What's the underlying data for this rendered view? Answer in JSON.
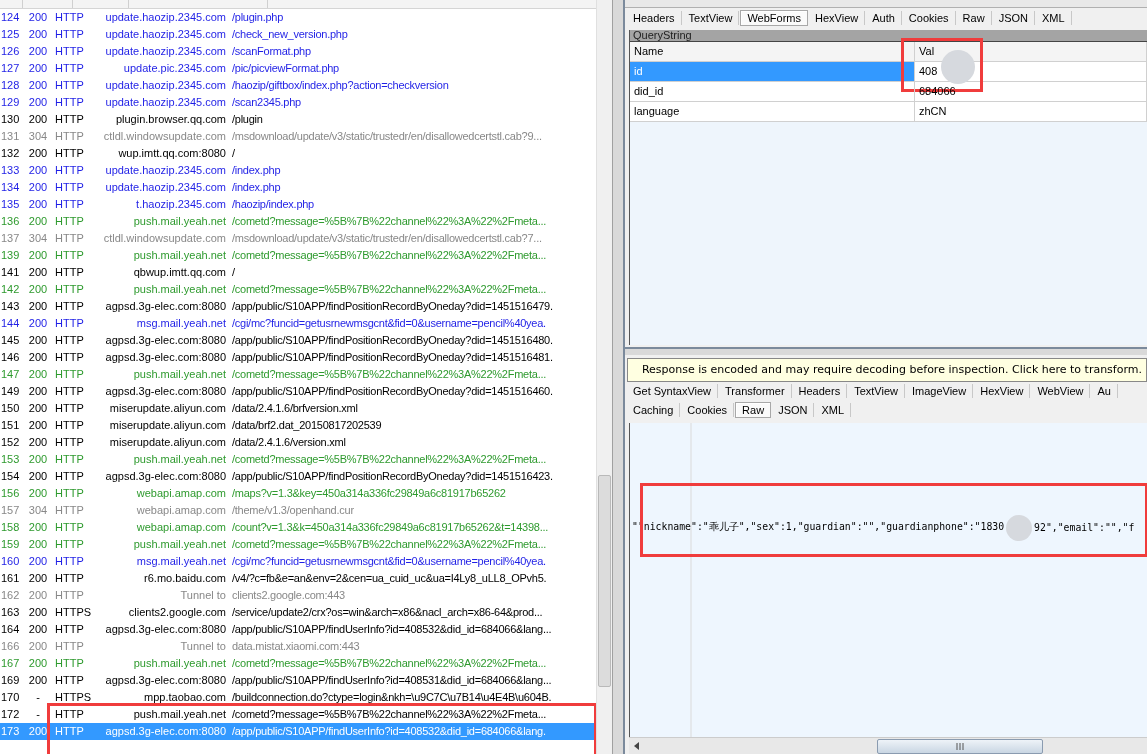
{
  "sessions": {
    "rows": [
      {
        "id": "124",
        "result": "200",
        "protocol": "HTTP",
        "host": "update.haozip.2345.com",
        "url": "/plugin.php",
        "color": "#1f1fe6",
        "selected": false,
        "highlighted": false
      },
      {
        "id": "125",
        "result": "200",
        "protocol": "HTTP",
        "host": "update.haozip.2345.com",
        "url": "/check_new_version.php",
        "color": "#1f1fe6",
        "selected": false,
        "highlighted": false
      },
      {
        "id": "126",
        "result": "200",
        "protocol": "HTTP",
        "host": "update.haozip.2345.com",
        "url": "/scanFormat.php",
        "color": "#1f1fe6",
        "selected": false,
        "highlighted": false
      },
      {
        "id": "127",
        "result": "200",
        "protocol": "HTTP",
        "host": "update.pic.2345.com",
        "url": "/pic/picviewFormat.php",
        "color": "#1f1fe6",
        "selected": false,
        "highlighted": false
      },
      {
        "id": "128",
        "result": "200",
        "protocol": "HTTP",
        "host": "update.haozip.2345.com",
        "url": "/haozip/giftbox/index.php?action=checkversion",
        "color": "#1f1fe6",
        "selected": false,
        "highlighted": false
      },
      {
        "id": "129",
        "result": "200",
        "protocol": "HTTP",
        "host": "update.haozip.2345.com",
        "url": "/scan2345.php",
        "color": "#1f1fe6",
        "selected": false,
        "highlighted": false
      },
      {
        "id": "130",
        "result": "200",
        "protocol": "HTTP",
        "host": "plugin.browser.qq.com",
        "url": "/plugin",
        "color": "#000000",
        "selected": false,
        "highlighted": false
      },
      {
        "id": "131",
        "result": "304",
        "protocol": "HTTP",
        "host": "ctldl.windowsupdate.com",
        "url": "/msdownload/update/v3/static/trustedr/en/disallowedcertstl.cab?9...",
        "color": "#888888",
        "selected": false,
        "highlighted": false
      },
      {
        "id": "132",
        "result": "200",
        "protocol": "HTTP",
        "host": "wup.imtt.qq.com:8080",
        "url": "/",
        "color": "#000000",
        "selected": false,
        "highlighted": false
      },
      {
        "id": "133",
        "result": "200",
        "protocol": "HTTP",
        "host": "update.haozip.2345.com",
        "url": "/index.php",
        "color": "#1f1fe6",
        "selected": false,
        "highlighted": false
      },
      {
        "id": "134",
        "result": "200",
        "protocol": "HTTP",
        "host": "update.haozip.2345.com",
        "url": "/index.php",
        "color": "#1f1fe6",
        "selected": false,
        "highlighted": false
      },
      {
        "id": "135",
        "result": "200",
        "protocol": "HTTP",
        "host": "t.haozip.2345.com",
        "url": "/haozip/index.php",
        "color": "#1f1fe6",
        "selected": false,
        "highlighted": false
      },
      {
        "id": "136",
        "result": "200",
        "protocol": "HTTP",
        "host": "push.mail.yeah.net",
        "url": "/cometd?message=%5B%7B%22channel%22%3A%22%2Fmeta...",
        "color": "#2e9a2e",
        "selected": false,
        "highlighted": false
      },
      {
        "id": "137",
        "result": "304",
        "protocol": "HTTP",
        "host": "ctldl.windowsupdate.com",
        "url": "/msdownload/update/v3/static/trustedr/en/disallowedcertstl.cab?7...",
        "color": "#888888",
        "selected": false,
        "highlighted": false
      },
      {
        "id": "139",
        "result": "200",
        "protocol": "HTTP",
        "host": "push.mail.yeah.net",
        "url": "/cometd?message=%5B%7B%22channel%22%3A%22%2Fmeta...",
        "color": "#2e9a2e",
        "selected": false,
        "highlighted": false
      },
      {
        "id": "141",
        "result": "200",
        "protocol": "HTTP",
        "host": "qbwup.imtt.qq.com",
        "url": "/",
        "color": "#000000",
        "selected": false,
        "highlighted": false
      },
      {
        "id": "142",
        "result": "200",
        "protocol": "HTTP",
        "host": "push.mail.yeah.net",
        "url": "/cometd?message=%5B%7B%22channel%22%3A%22%2Fmeta...",
        "color": "#2e9a2e",
        "selected": false,
        "highlighted": false
      },
      {
        "id": "143",
        "result": "200",
        "protocol": "HTTP",
        "host": "agpsd.3g-elec.com:8080",
        "url": "/app/public/S10APP/findPositionRecordByOneday?did=1451516479.",
        "color": "#000000",
        "selected": false,
        "highlighted": false
      },
      {
        "id": "144",
        "result": "200",
        "protocol": "HTTP",
        "host": "msg.mail.yeah.net",
        "url": "/cgi/mc?funcid=getusrnewmsgcnt&fid=0&username=pencil%40yea.",
        "color": "#1f1fe6",
        "selected": false,
        "highlighted": false
      },
      {
        "id": "145",
        "result": "200",
        "protocol": "HTTP",
        "host": "agpsd.3g-elec.com:8080",
        "url": "/app/public/S10APP/findPositionRecordByOneday?did=1451516480.",
        "color": "#000000",
        "selected": false,
        "highlighted": false
      },
      {
        "id": "146",
        "result": "200",
        "protocol": "HTTP",
        "host": "agpsd.3g-elec.com:8080",
        "url": "/app/public/S10APP/findPositionRecordByOneday?did=1451516481.",
        "color": "#000000",
        "selected": false,
        "highlighted": false
      },
      {
        "id": "147",
        "result": "200",
        "protocol": "HTTP",
        "host": "push.mail.yeah.net",
        "url": "/cometd?message=%5B%7B%22channel%22%3A%22%2Fmeta...",
        "color": "#2e9a2e",
        "selected": false,
        "highlighted": false
      },
      {
        "id": "149",
        "result": "200",
        "protocol": "HTTP",
        "host": "agpsd.3g-elec.com:8080",
        "url": "/app/public/S10APP/findPositionRecordByOneday?did=1451516460.",
        "color": "#000000",
        "selected": false,
        "highlighted": false
      },
      {
        "id": "150",
        "result": "200",
        "protocol": "HTTP",
        "host": "miserupdate.aliyun.com",
        "url": "/data/2.4.1.6/brfversion.xml",
        "color": "#000000",
        "selected": false,
        "highlighted": false
      },
      {
        "id": "151",
        "result": "200",
        "protocol": "HTTP",
        "host": "miserupdate.aliyun.com",
        "url": "/data/brf2.dat_20150817202539",
        "color": "#000000",
        "selected": false,
        "highlighted": false
      },
      {
        "id": "152",
        "result": "200",
        "protocol": "HTTP",
        "host": "miserupdate.aliyun.com",
        "url": "/data/2.4.1.6/version.xml",
        "color": "#000000",
        "selected": false,
        "highlighted": false
      },
      {
        "id": "153",
        "result": "200",
        "protocol": "HTTP",
        "host": "push.mail.yeah.net",
        "url": "/cometd?message=%5B%7B%22channel%22%3A%22%2Fmeta...",
        "color": "#2e9a2e",
        "selected": false,
        "highlighted": false
      },
      {
        "id": "154",
        "result": "200",
        "protocol": "HTTP",
        "host": "agpsd.3g-elec.com:8080",
        "url": "/app/public/S10APP/findPositionRecordByOneday?did=1451516423.",
        "color": "#000000",
        "selected": false,
        "highlighted": false
      },
      {
        "id": "156",
        "result": "200",
        "protocol": "HTTP",
        "host": "webapi.amap.com",
        "url": "/maps?v=1.3&key=450a314a336fc29849a6c81917b65262",
        "color": "#2e9a2e",
        "selected": false,
        "highlighted": false
      },
      {
        "id": "157",
        "result": "304",
        "protocol": "HTTP",
        "host": "webapi.amap.com",
        "url": "/theme/v1.3/openhand.cur",
        "color": "#888888",
        "selected": false,
        "highlighted": false
      },
      {
        "id": "158",
        "result": "200",
        "protocol": "HTTP",
        "host": "webapi.amap.com",
        "url": "/count?v=1.3&k=450a314a336fc29849a6c81917b65262&t=14398...",
        "color": "#2e9a2e",
        "selected": false,
        "highlighted": false
      },
      {
        "id": "159",
        "result": "200",
        "protocol": "HTTP",
        "host": "push.mail.yeah.net",
        "url": "/cometd?message=%5B%7B%22channel%22%3A%22%2Fmeta...",
        "color": "#2e9a2e",
        "selected": false,
        "highlighted": false
      },
      {
        "id": "160",
        "result": "200",
        "protocol": "HTTP",
        "host": "msg.mail.yeah.net",
        "url": "/cgi/mc?funcid=getusrnewmsgcnt&fid=0&username=pencil%40yea.",
        "color": "#1f1fe6",
        "selected": false,
        "highlighted": false
      },
      {
        "id": "161",
        "result": "200",
        "protocol": "HTTP",
        "host": "r6.mo.baidu.com",
        "url": "/v4/?c=fb&e=an&env=2&cen=ua_cuid_uc&ua=I4Ly8_uLL8_OPvh5.",
        "color": "#000000",
        "selected": false,
        "highlighted": false
      },
      {
        "id": "162",
        "result": "200",
        "protocol": "HTTP",
        "host": "Tunnel to",
        "url": "clients2.google.com:443",
        "color": "#888888",
        "selected": false,
        "highlighted": false
      },
      {
        "id": "163",
        "result": "200",
        "protocol": "HTTPS",
        "host": "clients2.google.com",
        "url": "/service/update2/crx?os=win&arch=x86&nacl_arch=x86-64&prod...",
        "color": "#000000",
        "selected": false,
        "highlighted": false
      },
      {
        "id": "164",
        "result": "200",
        "protocol": "HTTP",
        "host": "agpsd.3g-elec.com:8080",
        "url": "/app/public/S10APP/findUserInfo?id=408532&did_id=684066&lang...",
        "color": "#000000",
        "selected": false,
        "highlighted": false
      },
      {
        "id": "166",
        "result": "200",
        "protocol": "HTTP",
        "host": "Tunnel to",
        "url": "data.mistat.xiaomi.com:443",
        "color": "#888888",
        "selected": false,
        "highlighted": false
      },
      {
        "id": "167",
        "result": "200",
        "protocol": "HTTP",
        "host": "push.mail.yeah.net",
        "url": "/cometd?message=%5B%7B%22channel%22%3A%22%2Fmeta...",
        "color": "#2e9a2e",
        "selected": false,
        "highlighted": false
      },
      {
        "id": "169",
        "result": "200",
        "protocol": "HTTP",
        "host": "agpsd.3g-elec.com:8080",
        "url": "/app/public/S10APP/findUserInfo?id=408531&did_id=684066&lang...",
        "color": "#000000",
        "selected": false,
        "highlighted": false
      },
      {
        "id": "170",
        "result": "-",
        "protocol": "HTTPS",
        "host": "mpp.taobao.com",
        "url": "/buildconnection.do?ctype=login&nkh=\\u9C7C\\u7B14\\u4E4B\\u604B.",
        "color": "#000000",
        "selected": false,
        "highlighted": false
      },
      {
        "id": "172",
        "result": "-",
        "protocol": "HTTP",
        "host": "push.mail.yeah.net",
        "url": "/cometd?message=%5B%7B%22channel%22%3A%22%2Fmeta...",
        "color": "#000000",
        "selected": false,
        "highlighted": true
      },
      {
        "id": "173",
        "result": "200",
        "protocol": "HTTP",
        "host": "agpsd.3g-elec.com:8080",
        "url": "/app/public/S10APP/findUserInfo?id=408532&did_id=684066&lang.",
        "selected": true,
        "highlighted": true
      }
    ]
  },
  "request": {
    "tabs": [
      {
        "label": "Headers",
        "selected": false
      },
      {
        "label": "TextView",
        "selected": false
      },
      {
        "label": "WebForms",
        "selected": true
      },
      {
        "label": "HexView",
        "selected": false
      },
      {
        "label": "Auth",
        "selected": false
      },
      {
        "label": "Cookies",
        "selected": false
      },
      {
        "label": "Raw",
        "selected": false
      },
      {
        "label": "JSON",
        "selected": false
      },
      {
        "label": "XML",
        "selected": false
      }
    ],
    "section_title": "QueryString",
    "columns": [
      "Name",
      "Val"
    ],
    "params": [
      {
        "name": "id",
        "value": "408",
        "selected": true,
        "redacted": true,
        "highlighted": true
      },
      {
        "name": "did_id",
        "value": "684066",
        "selected": false,
        "redacted": false,
        "highlighted": false
      },
      {
        "name": "language",
        "value": "zhCN",
        "selected": false,
        "redacted": false,
        "highlighted": false
      }
    ]
  },
  "response": {
    "notice": "Response is encoded and may require decoding before inspection. Click here to transform.",
    "tabs_row_1": [
      {
        "label": "Get SyntaxView",
        "selected": false
      },
      {
        "label": "Transformer",
        "selected": false
      },
      {
        "label": "Headers",
        "selected": false
      },
      {
        "label": "TextView",
        "selected": false
      },
      {
        "label": "ImageView",
        "selected": false
      },
      {
        "label": "HexView",
        "selected": false
      },
      {
        "label": "WebView",
        "selected": false
      },
      {
        "label": "Au",
        "selected": false
      }
    ],
    "tabs_row_2": [
      {
        "label": "Caching",
        "selected": false
      },
      {
        "label": "Cookies",
        "selected": false
      },
      {
        "label": "Raw",
        "selected": true
      },
      {
        "label": "JSON",
        "selected": false
      },
      {
        "label": "XML",
        "selected": false
      }
    ],
    "raw": {
      "highlighted": true,
      "segments": [
        {
          "kind": "text",
          "text": "\"\"nickname\":\"乖儿子\",\"sex\":1,\"guardian\":\"\",\"guardianphone\":\"1830"
        },
        {
          "kind": "redaction"
        },
        {
          "kind": "text",
          "text": "92\",\"email\":\"\",\"f"
        }
      ]
    }
  }
}
